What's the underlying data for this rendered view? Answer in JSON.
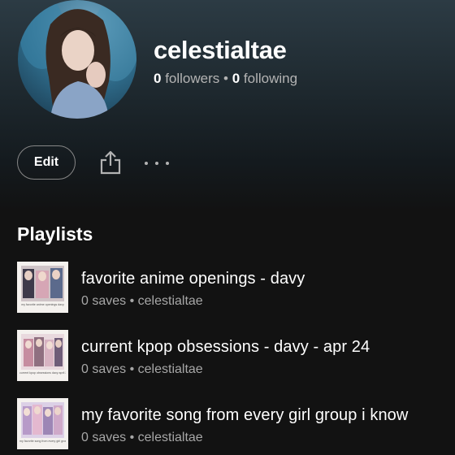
{
  "profile": {
    "name": "celestialtae",
    "followers_count": "0",
    "followers_label": "followers",
    "separator": "•",
    "following_count": "0",
    "following_label": "following"
  },
  "actions": {
    "edit_label": "Edit",
    "share_icon": "share-icon",
    "more_icon": "more-options-icon"
  },
  "playlists": {
    "section_title": "Playlists",
    "items": [
      {
        "title": "favorite anime openings - davy",
        "saves": "0 saves",
        "owner": "celestialtae",
        "separator": "•",
        "cover_caption": "my favorite anime openings davy"
      },
      {
        "title": "current kpop obsessions - davy - apr 24",
        "saves": "0 saves",
        "owner": "celestialtae",
        "separator": "•",
        "cover_caption": "current kpop obsessions davy april 2024"
      },
      {
        "title": "my favorite song from every girl group i know",
        "saves": "0 saves",
        "owner": "celestialtae",
        "separator": "•",
        "cover_caption": "my favorite song from every girl group i know"
      }
    ]
  },
  "colors": {
    "background": "#121212",
    "header_tint": "#2c3b44",
    "secondary_text": "#b3b3b3"
  }
}
